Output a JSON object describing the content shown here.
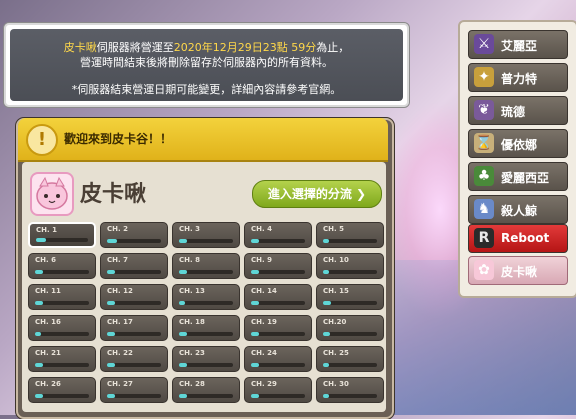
{
  "notice": {
    "line1_server": "皮卡啾",
    "line1_a": "伺服器將營運至",
    "line1_date": "2020年12月29日23點 59分",
    "line1_b": "為止，",
    "line2": "營運時間結束後將刪除留存於伺服器內的所有資料。",
    "line3": "*伺服器結束營運日期可能變更，詳細內容請參考官網。"
  },
  "welcome": {
    "icon": "!",
    "text": "歡迎來到皮卡谷！！"
  },
  "server": {
    "title": "皮卡啾",
    "enter_label": "進入選擇的分流 ❯"
  },
  "channels": [
    {
      "label": "CH. 1",
      "load": 0.2,
      "selected": true
    },
    {
      "label": "CH. 2",
      "load": 0.18
    },
    {
      "label": "CH. 3",
      "load": 0.15
    },
    {
      "label": "CH. 4",
      "load": 0.15
    },
    {
      "label": "CH. 5",
      "load": 0.12
    },
    {
      "label": "CH. 6",
      "load": 0.14
    },
    {
      "label": "CH. 7",
      "load": 0.15
    },
    {
      "label": "CH. 8",
      "load": 0.15
    },
    {
      "label": "CH. 9",
      "load": 0.15
    },
    {
      "label": "CH. 10",
      "load": 0.12
    },
    {
      "label": "CH. 11",
      "load": 0.14
    },
    {
      "label": "CH. 12",
      "load": 0.15
    },
    {
      "label": "CH. 13",
      "load": 0.12
    },
    {
      "label": "CH. 14",
      "load": 0.15
    },
    {
      "label": "CH. 15",
      "load": 0.14
    },
    {
      "label": "CH. 16",
      "load": 0.12
    },
    {
      "label": "CH. 17",
      "load": 0.15
    },
    {
      "label": "CH. 18",
      "load": 0.14
    },
    {
      "label": "CH. 19",
      "load": 0.15
    },
    {
      "label": "CH.20",
      "load": 0.13
    },
    {
      "label": "CH. 21",
      "load": 0.14
    },
    {
      "label": "CH. 22",
      "load": 0.14
    },
    {
      "label": "CH. 23",
      "load": 0.15
    },
    {
      "label": "CH. 24",
      "load": 0.15
    },
    {
      "label": "CH. 25",
      "load": 0.12
    },
    {
      "label": "CH. 26",
      "load": 0.15
    },
    {
      "label": "CH. 27",
      "load": 0.14
    },
    {
      "label": "CH. 28",
      "load": 0.15
    },
    {
      "label": "CH. 29",
      "load": 0.15
    },
    {
      "label": "CH. 30",
      "load": 0.12
    }
  ],
  "worlds": [
    {
      "label": "艾麗亞",
      "icon": "⚔",
      "icon_name": "sword-icon",
      "color": "#6a4a9a"
    },
    {
      "label": "普力特",
      "icon": "✦",
      "icon_name": "staff-icon",
      "color": "#c8a03c"
    },
    {
      "label": "琉德",
      "icon": "❦",
      "icon_name": "claw-icon",
      "color": "#7a5a9a"
    },
    {
      "label": "優依娜",
      "icon": "⌛",
      "icon_name": "hourglass-icon",
      "color": "#c8b07a"
    },
    {
      "label": "愛麗西亞",
      "icon": "♣",
      "icon_name": "tree-icon",
      "color": "#4a8a3a"
    },
    {
      "label": "殺人鯨",
      "icon": "♞",
      "icon_name": "whale-icon",
      "color": "#6a8ac8"
    },
    {
      "label": "Reboot",
      "icon": "R",
      "icon_name": "reboot-icon",
      "color": "#2a2a2a"
    },
    {
      "label": "皮卡啾",
      "icon": "✿",
      "icon_name": "pinkbean-icon",
      "color": "#f7c8d8"
    }
  ],
  "colors": {
    "channel_fill": "#5fd6d6",
    "reboot": "#d42424",
    "accent_yellow": "#ffd84a"
  }
}
